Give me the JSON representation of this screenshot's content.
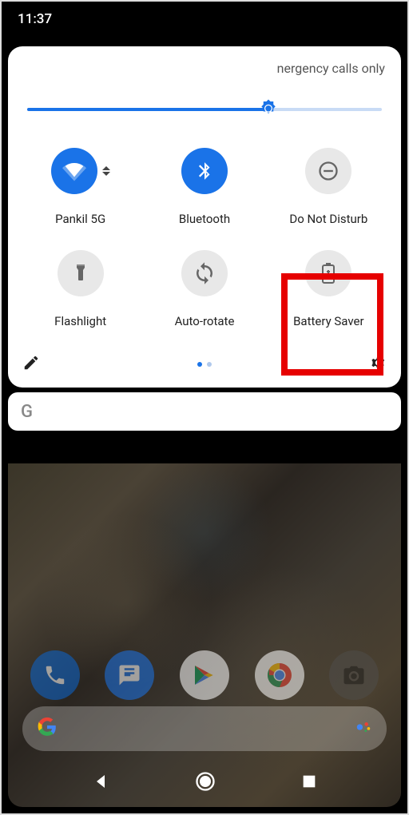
{
  "status": {
    "time": "11:37"
  },
  "qs": {
    "header": "nergency calls only",
    "brightness_percent": 68,
    "tiles": [
      {
        "label": "Pankil 5G",
        "icon": "wifi-icon",
        "active": true,
        "expandable": true
      },
      {
        "label": "Bluetooth",
        "icon": "bluetooth-icon",
        "active": true
      },
      {
        "label": "Do Not Disturb",
        "icon": "dnd-icon",
        "active": false
      },
      {
        "label": "Flashlight",
        "icon": "flashlight-icon",
        "active": false
      },
      {
        "label": "Auto-rotate",
        "icon": "rotate-icon",
        "active": false
      },
      {
        "label": "Battery Saver",
        "icon": "battery-saver-icon",
        "active": false,
        "highlighted": true
      }
    ],
    "page_count": 2,
    "active_page": 0
  },
  "search_card": {
    "provider_letter": "G"
  },
  "dock": {
    "apps": [
      {
        "name": "phone",
        "bg": "#0b66d0"
      },
      {
        "name": "messages",
        "bg": "#1a73e8"
      },
      {
        "name": "play-store",
        "bg": "#ffffff"
      },
      {
        "name": "chrome",
        "bg": "#ffffff"
      },
      {
        "name": "camera",
        "bg": "#3a3a3a"
      }
    ]
  },
  "colors": {
    "accent": "#1a73e8",
    "highlight": "#e60000",
    "inactive_tile": "#e8e8e8"
  }
}
